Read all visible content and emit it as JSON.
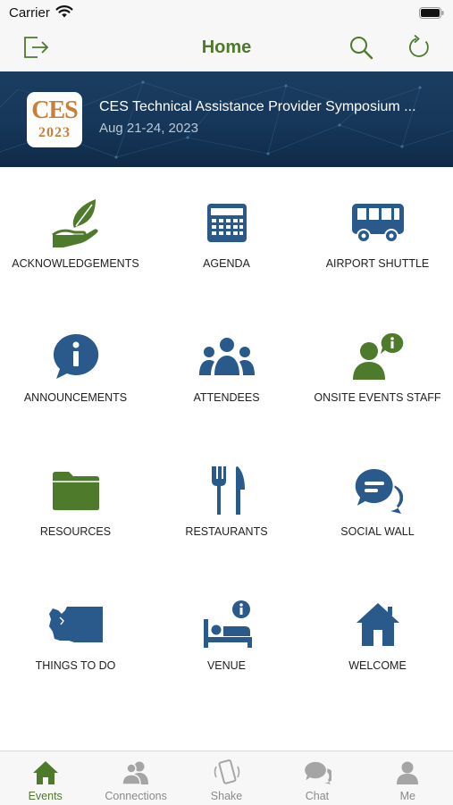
{
  "status_bar": {
    "carrier": "Carrier"
  },
  "nav": {
    "title": "Home"
  },
  "event": {
    "logo_top": "CES",
    "logo_bottom": "2023",
    "title": "CES Technical Assistance Provider Symposium ...",
    "dates": "Aug 21-24, 2023"
  },
  "colors": {
    "green": "#4e7a2c",
    "blue": "#2a5a8c",
    "banner": "#16375a"
  },
  "tiles": [
    {
      "label": "ACKNOWLEDGEMENTS",
      "icon": "hand-leaf-icon"
    },
    {
      "label": "AGENDA",
      "icon": "calendar-icon"
    },
    {
      "label": "AIRPORT SHUTTLE",
      "icon": "bus-icon"
    },
    {
      "label": "ANNOUNCEMENTS",
      "icon": "info-bubble-icon"
    },
    {
      "label": "ATTENDEES",
      "icon": "people-icon"
    },
    {
      "label": "ONSITE EVENTS STAFF",
      "icon": "staff-info-icon"
    },
    {
      "label": "RESOURCES",
      "icon": "folder-icon"
    },
    {
      "label": "RESTAURANTS",
      "icon": "fork-knife-icon"
    },
    {
      "label": "SOCIAL WALL",
      "icon": "chat-bubbles-icon"
    },
    {
      "label": "THINGS TO DO",
      "icon": "washington-map-icon"
    },
    {
      "label": "VENUE",
      "icon": "bed-info-icon"
    },
    {
      "label": "WELCOME",
      "icon": "house-icon"
    }
  ],
  "tabs": [
    {
      "label": "Events",
      "icon": "home-icon",
      "active": true
    },
    {
      "label": "Connections",
      "icon": "people-icon"
    },
    {
      "label": "Shake",
      "icon": "phone-shake-icon"
    },
    {
      "label": "Chat",
      "icon": "chat-icon"
    },
    {
      "label": "Me",
      "icon": "person-icon"
    }
  ]
}
